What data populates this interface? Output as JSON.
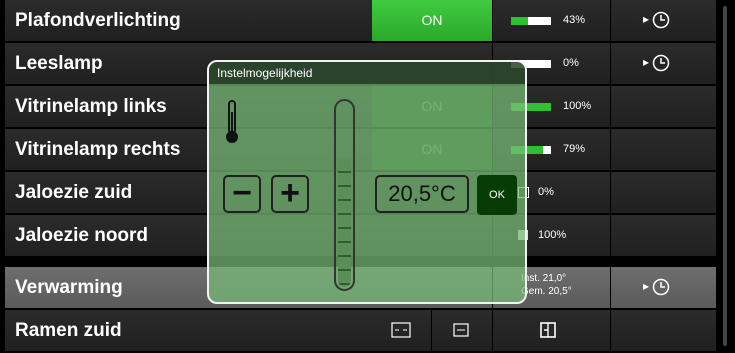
{
  "rows": [
    {
      "label": "Plafondverlichting",
      "col1": "ON",
      "pct": "43%"
    },
    {
      "label": "Leeslamp",
      "pct": "0%"
    },
    {
      "label": "Vitrinelamp links",
      "col1": "ON",
      "pct": "100%"
    },
    {
      "label": "Vitrinelamp rechts",
      "col1": "ON",
      "pct": "79%"
    },
    {
      "label": "Jaloezie zuid",
      "pct": "0%"
    },
    {
      "label": "Jaloezie noord",
      "pct": "100%"
    },
    {
      "label": "Verwarming",
      "inst": "Inst. 21,0°",
      "gem": "Gem. 20,5°"
    },
    {
      "label": "Ramen zuid"
    }
  ],
  "popup": {
    "title": "Instelmogelijkheid",
    "minus": "−",
    "plus": "+",
    "temp": "20,5°C",
    "ok": "OK",
    "slider_level": 0.68
  },
  "colors": {
    "green": "#2fbf2f",
    "popup": "#78be78"
  }
}
